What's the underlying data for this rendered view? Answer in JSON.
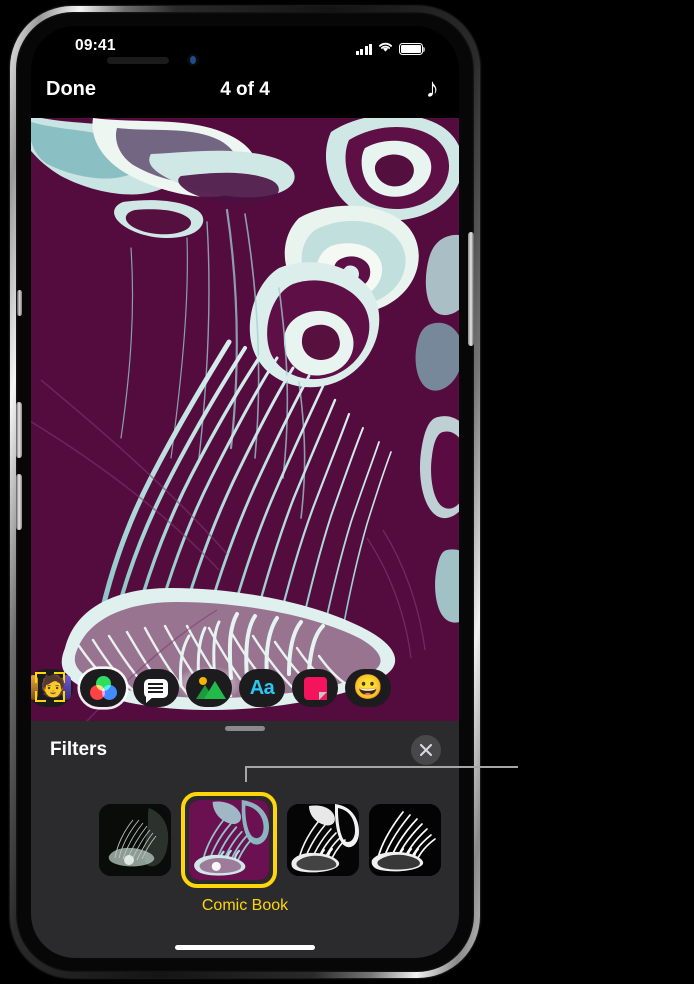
{
  "device": {
    "name": "iphone",
    "notch_icons": [
      "speaker-grille",
      "front-camera"
    ],
    "buttons": [
      "silent-switch",
      "volume-up",
      "volume-down",
      "power"
    ]
  },
  "status_bar": {
    "time": "09:41",
    "cellular_icon": "signal-bars-icon",
    "wifi_icon": "wifi-icon",
    "battery_icon": "battery-icon"
  },
  "nav_bar": {
    "done_label": "Done",
    "title": "4 of 4",
    "music_icon": "music-note-icon"
  },
  "canvas": {
    "name": "photo-preview",
    "description": "jellyfish photo with Comic Book filter applied",
    "background_color": "#5a0b41",
    "accent_color": "#bfe3e3"
  },
  "app_strip": {
    "items": [
      {
        "name": "memoji-app-icon",
        "icon": "memoji-icon",
        "label": "",
        "selected": false
      },
      {
        "name": "filters-app-icon",
        "icon": "rgb-circles-icon",
        "label": "",
        "selected": true
      },
      {
        "name": "messages-app-icon",
        "icon": "speech-bubble-icon",
        "label": "",
        "selected": false
      },
      {
        "name": "photos-app-icon",
        "icon": "photo-mountain-icon",
        "label": "",
        "selected": false
      },
      {
        "name": "text-app-icon",
        "icon": "aa-text-icon",
        "label": "Aa",
        "selected": false
      },
      {
        "name": "stickers-app-icon",
        "icon": "sticker-icon",
        "label": "",
        "selected": false
      },
      {
        "name": "emoji-app-icon",
        "icon": "grinning-face-icon",
        "label": "😀",
        "selected": false
      }
    ]
  },
  "filters_panel": {
    "title": "Filters",
    "close_icon": "close-icon",
    "grabber": "drag-handle",
    "selected_filter_label": "Comic Book",
    "selected_color": "#ffd60a",
    "panel_color": "#2b2b2d",
    "thumbnails": [
      {
        "name": "filter-thumb-1",
        "style": "original-dark",
        "selected": false
      },
      {
        "name": "filter-thumb-comic-book",
        "style": "comic-book",
        "selected": true
      },
      {
        "name": "filter-thumb-3",
        "style": "black-and-white-1",
        "selected": false
      },
      {
        "name": "filter-thumb-4",
        "style": "black-and-white-2",
        "selected": false
      }
    ]
  },
  "callout": {
    "name": "callout-leader-line",
    "color": "#a6a6a6",
    "points_to": "filter-thumb-comic-book"
  },
  "home_indicator": "home-indicator"
}
